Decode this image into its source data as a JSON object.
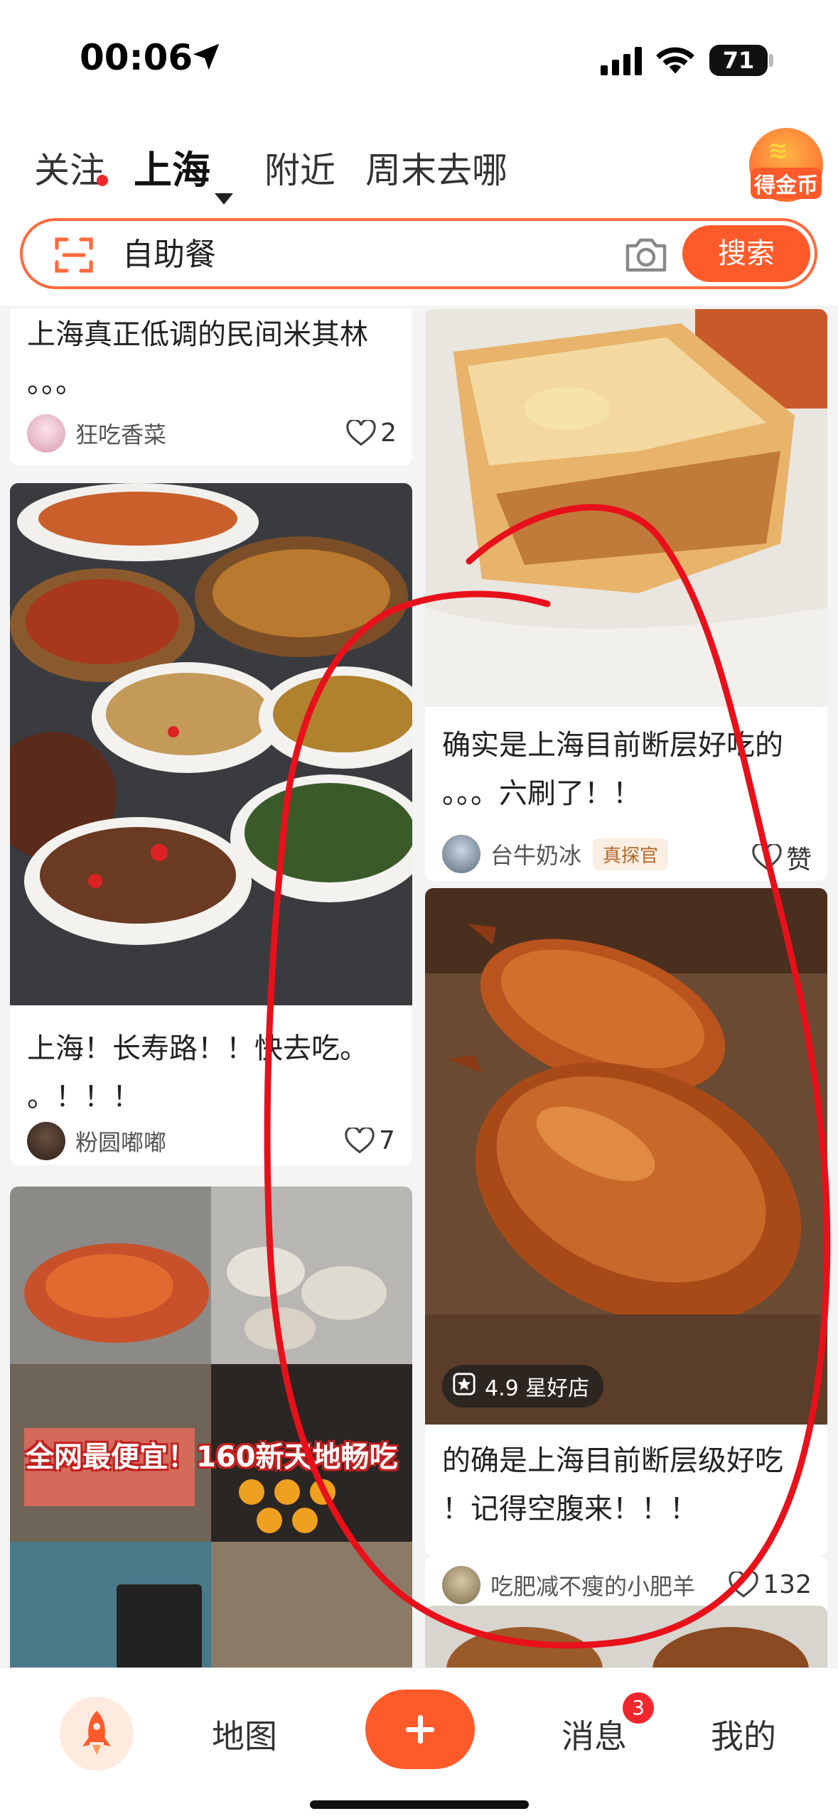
{
  "status_bar": {
    "time": "00:06",
    "battery": "71"
  },
  "tabs": {
    "follow": "关注",
    "city": "上海",
    "nearby": "附近",
    "weekend": "周末去哪"
  },
  "coin_badge": {
    "label": "得金币"
  },
  "search": {
    "query": "自助餐",
    "button": "搜索"
  },
  "feed": {
    "left": [
      {
        "title_line1": "上海真正低调的民间米其林",
        "title_line2": "。。。",
        "author": "狂吃香菜",
        "likes": "2"
      },
      {
        "title_line1": "上海！长寿路！！快去吃。",
        "title_line2": "。！！！",
        "author": "粉圆嘟嘟",
        "likes": "7"
      },
      {
        "promo_text": "全网最便宜！160新天地畅吃"
      }
    ],
    "right": [
      {
        "title_line1": "确实是上海目前断层好吃的",
        "title_line2": "。。。六刷了！！",
        "author": "台牛奶冰",
        "badge": "真探官",
        "likes": "赞"
      },
      {
        "rating": "4.9 星好店",
        "title_line1": "的确是上海目前断层级好吃",
        "title_line2": "！记得空腹来！！！",
        "author": "吃肥减不瘦的小肥羊",
        "likes": "132"
      }
    ]
  },
  "bottom_nav": {
    "map": "地图",
    "messages": "消息",
    "messages_badge": "3",
    "mine": "我的"
  },
  "colors": {
    "accent": "#ff5a2a",
    "annotation": "#e8101a"
  }
}
